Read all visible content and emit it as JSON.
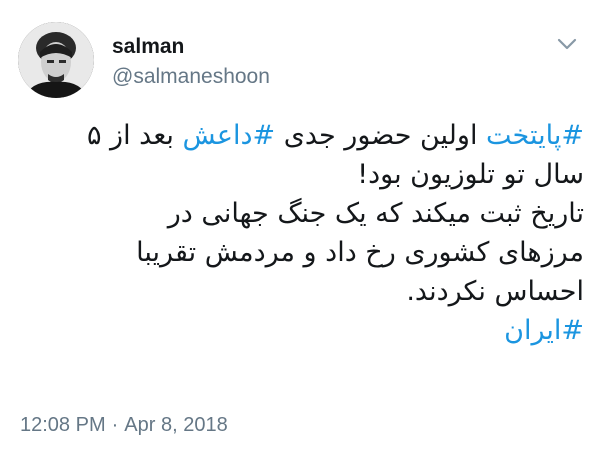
{
  "user": {
    "display_name": "salman",
    "handle": "@salmaneshoon"
  },
  "menu_icon": "chevron-down-icon",
  "tweet": {
    "line1": {
      "hashtag1": "#پایتخت",
      "text1": " اولین حضور جدی ",
      "hashtag2": "#داعش",
      "text2": " بعد از ۵"
    },
    "line2": "سال تو تلوزیون بود!",
    "line3": "تاریخ ثبت میکند که یک جنگ جهانی در",
    "line4": "مرزهای کشوری رخ داد و مردمش تقریبا",
    "line5": "احساس نکردند.",
    "line6_hashtag": "#ایران"
  },
  "meta": {
    "time": "12:08 PM",
    "separator": "·",
    "date": "Apr 8, 2018"
  },
  "colors": {
    "hashtag": "#1b95e0",
    "secondary_text": "#657786",
    "primary_text": "#14171a"
  }
}
